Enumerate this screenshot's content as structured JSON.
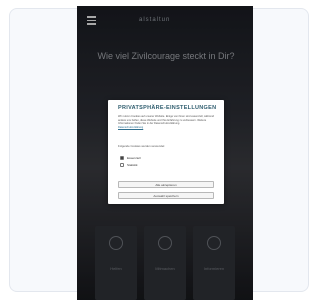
{
  "site": {
    "logo_text": "alstaltun",
    "hero_title": "Wie viel Zivilcourage steckt in Dir?"
  },
  "tiles": [
    {
      "icon": "hand-icon",
      "label": "Helfen"
    },
    {
      "icon": "chat-icon",
      "label": "Mitmachen"
    },
    {
      "icon": "arrow-icon",
      "label": "Informieren"
    }
  ],
  "consent": {
    "title": "PRIVATSPHÄRE-EINSTELLUNGEN",
    "body": "Wir nutzen Cookies auf unserer Website. Einige von ihnen sind essenziell, während andere uns helfen, diese Website und Ihre Erfahrung zu verbessern. Weitere Informationen finden Sie in der Datenschutzerklärung.",
    "link": "Datenschutzerklärung",
    "subheading": "Folgende Cookies werden verwendet:",
    "options": [
      {
        "label": "Essenziell",
        "checked": true
      },
      {
        "label": "Statistik",
        "checked": false
      }
    ],
    "save_label": "Alle akzeptieren",
    "accept_label": "Auswahl speichern"
  }
}
